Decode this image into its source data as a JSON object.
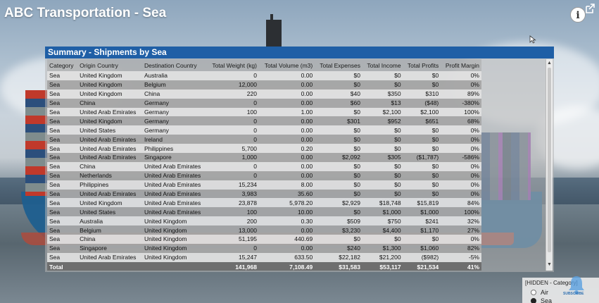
{
  "app": {
    "title": "ABC Transportation - Sea"
  },
  "visual": {
    "title": "Summary - Shipments by Sea",
    "columns": [
      "Category",
      "Origin Country",
      "Destination Country",
      "Total Weight (kg)",
      "Total Volume (m3)",
      "Total Expenses",
      "Total Income",
      "Total Profits",
      "Profit Margin"
    ],
    "rows": [
      [
        "Sea",
        "United Kingdom",
        "Australia",
        "0",
        "0.00",
        "$0",
        "$0",
        "$0",
        "0%"
      ],
      [
        "Sea",
        "United Kingdom",
        "Belgium",
        "12,000",
        "0.00",
        "$0",
        "$0",
        "$0",
        "0%"
      ],
      [
        "Sea",
        "United Kingdom",
        "China",
        "220",
        "0.00",
        "$40",
        "$350",
        "$310",
        "89%"
      ],
      [
        "Sea",
        "China",
        "Germany",
        "0",
        "0.00",
        "$60",
        "$13",
        "($48)",
        "-380%"
      ],
      [
        "Sea",
        "United Arab Emirates",
        "Germany",
        "100",
        "1.00",
        "$0",
        "$2,100",
        "$2,100",
        "100%"
      ],
      [
        "Sea",
        "United Kingdom",
        "Germany",
        "0",
        "0.00",
        "$301",
        "$952",
        "$651",
        "68%"
      ],
      [
        "Sea",
        "United States",
        "Germany",
        "0",
        "0.00",
        "$0",
        "$0",
        "$0",
        "0%"
      ],
      [
        "Sea",
        "United Arab Emirates",
        "Ireland",
        "0",
        "0.00",
        "$0",
        "$0",
        "$0",
        "0%"
      ],
      [
        "Sea",
        "United Arab Emirates",
        "Philippines",
        "5,700",
        "0.20",
        "$0",
        "$0",
        "$0",
        "0%"
      ],
      [
        "Sea",
        "United Arab Emirates",
        "Singapore",
        "1,000",
        "0.00",
        "$2,092",
        "$305",
        "($1,787)",
        "-586%"
      ],
      [
        "Sea",
        "China",
        "United Arab Emirates",
        "0",
        "0.00",
        "$0",
        "$0",
        "$0",
        "0%"
      ],
      [
        "Sea",
        "Netherlands",
        "United Arab Emirates",
        "0",
        "0.00",
        "$0",
        "$0",
        "$0",
        "0%"
      ],
      [
        "Sea",
        "Philippines",
        "United Arab Emirates",
        "15,234",
        "8.00",
        "$0",
        "$0",
        "$0",
        "0%"
      ],
      [
        "Sea",
        "United Arab Emirates",
        "United Arab Emirates",
        "3,983",
        "35.60",
        "$0",
        "$0",
        "$0",
        "0%"
      ],
      [
        "Sea",
        "United Kingdom",
        "United Arab Emirates",
        "23,878",
        "5,978.20",
        "$2,929",
        "$18,748",
        "$15,819",
        "84%"
      ],
      [
        "Sea",
        "United States",
        "United Arab Emirates",
        "100",
        "10.00",
        "$0",
        "$1,000",
        "$1,000",
        "100%"
      ],
      [
        "Sea",
        "Australia",
        "United Kingdom",
        "200",
        "0.30",
        "$509",
        "$750",
        "$241",
        "32%"
      ],
      [
        "Sea",
        "Belgium",
        "United Kingdom",
        "13,000",
        "0.00",
        "$3,230",
        "$4,400",
        "$1,170",
        "27%"
      ],
      [
        "Sea",
        "China",
        "United Kingdom",
        "51,195",
        "440.69",
        "$0",
        "$0",
        "$0",
        "0%"
      ],
      [
        "Sea",
        "Singapore",
        "United Kingdom",
        "0",
        "0.00",
        "$240",
        "$1,300",
        "$1,060",
        "82%"
      ],
      [
        "Sea",
        "United Arab Emirates",
        "United Kingdom",
        "15,247",
        "633.50",
        "$22,182",
        "$21,200",
        "($982)",
        "-5%"
      ]
    ],
    "total": [
      "Total",
      "",
      "",
      "141,968",
      "7,108.49",
      "$31,583",
      "$53,117",
      "$21,534",
      "41%"
    ]
  },
  "slicer": {
    "title": "[HIDDEN - Category]",
    "options": [
      {
        "label": "Air",
        "selected": false
      },
      {
        "label": "Sea",
        "selected": true
      }
    ]
  },
  "subscribe": {
    "label": "SUBSCRIBE"
  },
  "icons": {
    "info": "info-icon",
    "popout": "popout-icon",
    "cursor": "cursor-icon"
  }
}
